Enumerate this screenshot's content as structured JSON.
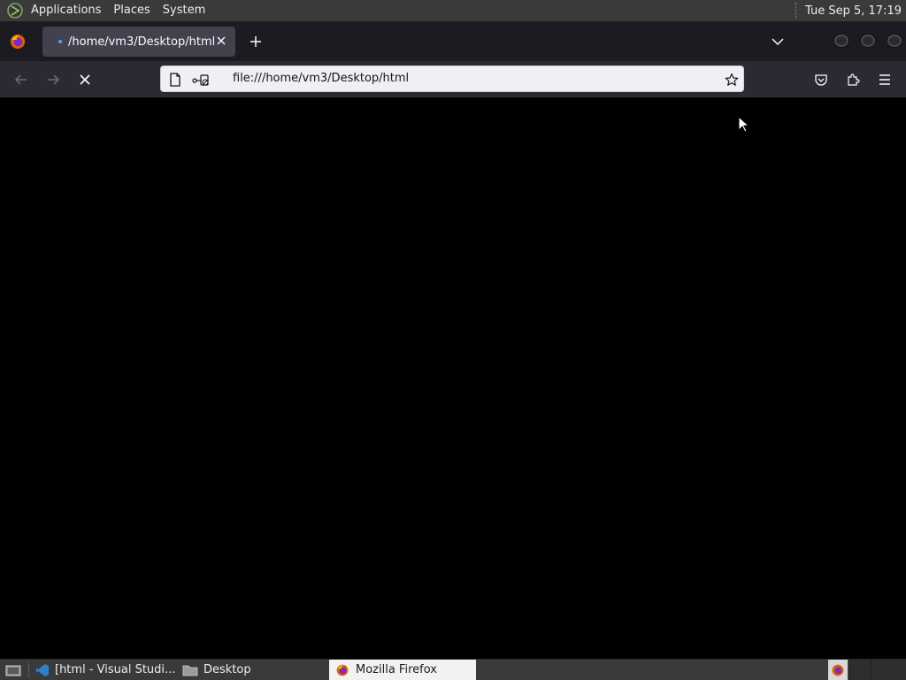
{
  "top_panel": {
    "menu": [
      "Applications",
      "Places",
      "System"
    ],
    "clock": "Tue Sep  5, 17:19"
  },
  "browser": {
    "tab": {
      "title": "/home/vm3/Desktop/html"
    },
    "url": "file:///home/vm3/Desktop/html",
    "loading": true
  },
  "taskbar": {
    "items": [
      {
        "label": "[html - Visual Studi...",
        "icon": "vscode-icon"
      },
      {
        "label": "Desktop",
        "icon": "folder-icon"
      },
      {
        "label": "Mozilla Firefox",
        "icon": "firefox-icon"
      }
    ]
  },
  "colors": {
    "panel": "#3a3a3a",
    "tabbar": "#1c1b22",
    "toolbar": "#2b2a33",
    "urlbar": "#f0f0f4",
    "content": "#000000"
  }
}
